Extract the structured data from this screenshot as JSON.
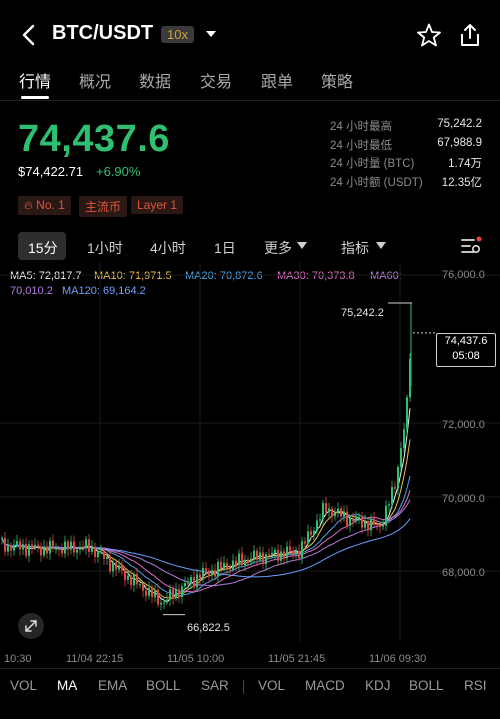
{
  "header": {
    "pair": "BTC/USDT",
    "leverage": "10x",
    "back_icon": "chevron-left-icon",
    "star_icon": "star-outline-icon",
    "share_icon": "share-icon"
  },
  "tabs": [
    {
      "label": "行情",
      "active": true
    },
    {
      "label": "概况",
      "active": false
    },
    {
      "label": "数据",
      "active": false
    },
    {
      "label": "交易",
      "active": false
    },
    {
      "label": "跟单",
      "active": false
    },
    {
      "label": "策略",
      "active": false
    }
  ],
  "price": {
    "last": "74,437.6",
    "usd": "$74,422.71",
    "change": "+6.90%"
  },
  "badges": [
    "No. 1",
    "主流币",
    "Layer 1"
  ],
  "stats": [
    {
      "label": "24 小时最高",
      "value": "75,242.2"
    },
    {
      "label": "24 小时最低",
      "value": "67,988.9"
    },
    {
      "label": "24 小时量 (BTC)",
      "value": "1.74万"
    },
    {
      "label": "24 小时额 (USDT)",
      "value": "12.35亿"
    }
  ],
  "intervals": {
    "items": [
      "15分",
      "1小时",
      "4小时",
      "1日",
      "更多",
      "指标"
    ],
    "active": "15分"
  },
  "ma_legend": [
    {
      "text": "MA5: 72,817.7",
      "color": "#f2f2f2"
    },
    {
      "text": "MA10: 71,971.5",
      "color": "#f1c14a"
    },
    {
      "text": "MA20: 70,872.6",
      "color": "#4aa6e8"
    },
    {
      "text": "MA30: 70,373.8",
      "color": "#e06cc8"
    },
    {
      "text": "MA60:",
      "color": "#b57ee0"
    },
    {
      "text": "70,010.2",
      "color": "#b57ee0"
    },
    {
      "text": "MA120: 69,164.2",
      "color": "#6fa0ff"
    }
  ],
  "colors": {
    "up": "#2fbf71",
    "down": "#e0473c",
    "accent": "#c8a43b"
  },
  "chart_data": {
    "type": "candlestick",
    "y_ticks": [
      "76,000.0",
      "72,000.0",
      "70,000.0",
      "68,000.0"
    ],
    "x_ticks": [
      "10:30",
      "11/04 22:15",
      "11/05 10:00",
      "11/05 21:45",
      "11/06 09:30"
    ],
    "high_label": "75,242.2",
    "low_label": "66,822.5",
    "last_price": "74,437.6",
    "countdown": "05:08",
    "ylim": [
      66500,
      76000
    ]
  },
  "bottom_indicators": [
    {
      "label": "VOL",
      "active": false
    },
    {
      "label": "MA",
      "active": true
    },
    {
      "label": "EMA",
      "active": false
    },
    {
      "label": "BOLL",
      "active": false
    },
    {
      "label": "SAR",
      "active": false
    },
    {
      "label": "VOL",
      "active": false
    },
    {
      "label": "MACD",
      "active": false
    },
    {
      "label": "KDJ",
      "active": false
    },
    {
      "label": "BOLL",
      "active": false
    },
    {
      "label": "RSI",
      "active": false
    }
  ]
}
